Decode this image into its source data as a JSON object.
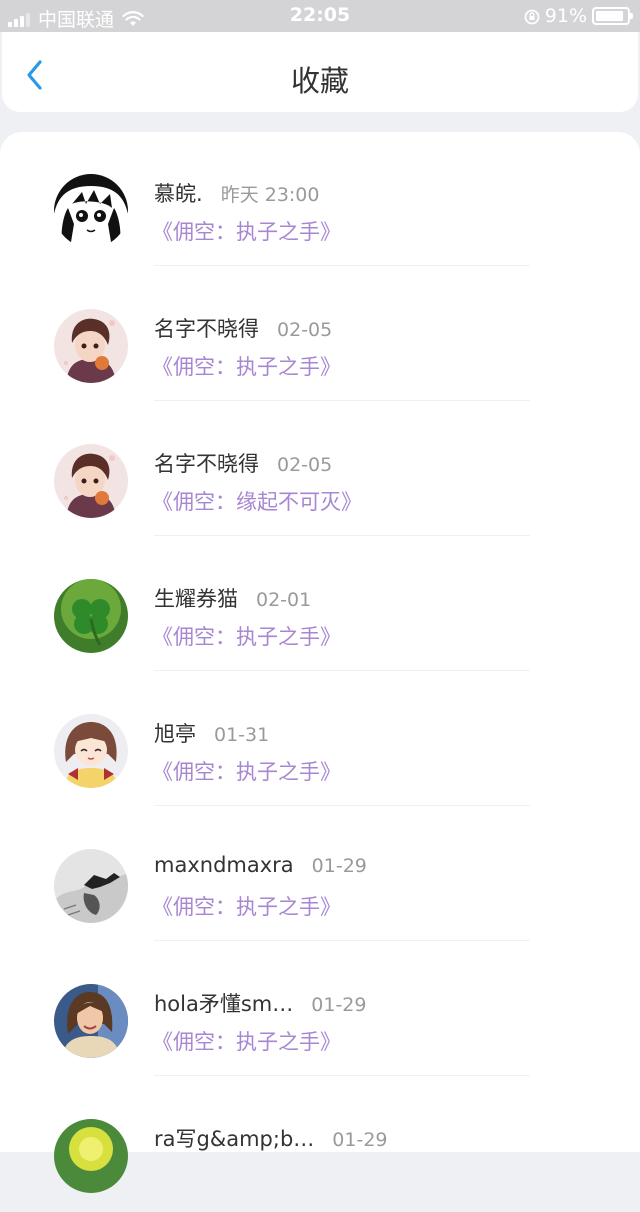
{
  "status_bar": {
    "carrier": "中国联通",
    "time": "22:05",
    "battery": "91%",
    "battery_level": 0.91
  },
  "header": {
    "title": "收藏",
    "back_icon": "chevron-left-icon",
    "accent_color": "#2a9ae6"
  },
  "favorites": [
    {
      "name": "慕皖.",
      "time": "昨天 23:00",
      "work": "《佣空：执子之手》",
      "avatar": "manga-girl-avatar"
    },
    {
      "name": "名字不晓得",
      "time": "02-05",
      "work": "《佣空：执子之手》",
      "avatar": "anime-boy-avatar"
    },
    {
      "name": "名字不晓得",
      "time": "02-05",
      "work": "《佣空：缘起不可灭》",
      "avatar": "anime-boy-avatar"
    },
    {
      "name": "生耀券猫",
      "time": "02-01",
      "work": "《佣空：执子之手》",
      "avatar": "clover-avatar"
    },
    {
      "name": "旭亭",
      "time": "01-31",
      "work": "《佣空：执子之手》",
      "avatar": "anime-girl-avatar"
    },
    {
      "name": "maxndmaxra",
      "time": "01-29",
      "work": "《佣空：执子之手》",
      "avatar": "sketch-avatar"
    },
    {
      "name": "hola矛懂sm…",
      "time": "01-29",
      "work": "《佣空：执子之手》",
      "avatar": "photo-woman-avatar"
    },
    {
      "name": "ra写g&amp;b…",
      "time": "01-29",
      "work": "",
      "avatar": "yellow-avatar"
    }
  ],
  "colors": {
    "work_link": "#a786d2",
    "name_text": "#333333",
    "time_text": "#9a9a9a"
  }
}
